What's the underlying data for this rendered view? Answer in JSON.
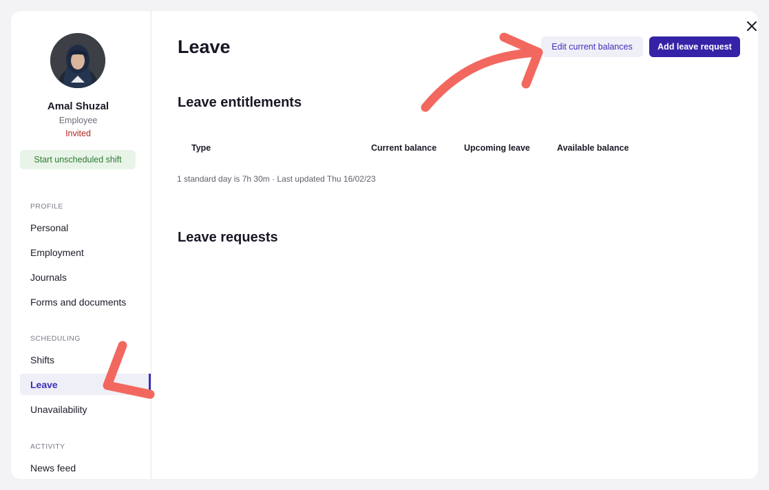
{
  "profile": {
    "name": "Amal Shuzal",
    "role": "Employee",
    "status": "Invited",
    "start_shift_label": "Start unscheduled shift"
  },
  "sidebar": {
    "sections": [
      {
        "label": "PROFILE",
        "items": [
          {
            "label": "Personal"
          },
          {
            "label": "Employment"
          },
          {
            "label": "Journals"
          },
          {
            "label": "Forms and documents"
          }
        ]
      },
      {
        "label": "SCHEDULING",
        "items": [
          {
            "label": "Shifts"
          },
          {
            "label": "Leave",
            "active": true
          },
          {
            "label": "Unavailability"
          }
        ]
      },
      {
        "label": "ACTIVITY",
        "items": [
          {
            "label": "News feed"
          }
        ]
      }
    ]
  },
  "main": {
    "title": "Leave",
    "edit_balances_label": "Edit current balances",
    "add_leave_label": "Add leave request",
    "entitlements": {
      "title": "Leave entitlements",
      "columns": [
        "Type",
        "Current balance",
        "Upcoming leave",
        "Available balance"
      ],
      "footnote": "1 standard day is 7h 30m · Last updated Thu 16/02/23"
    },
    "requests": {
      "title": "Leave requests"
    }
  },
  "colors": {
    "accent": "#3423a6",
    "active_nav": "#3b2fb6",
    "invited": "#b0261e",
    "success": "#2e7a35",
    "annotation_arrow": "#f2685e"
  },
  "icons": {
    "close": "close-icon",
    "avatar": "avatar"
  }
}
